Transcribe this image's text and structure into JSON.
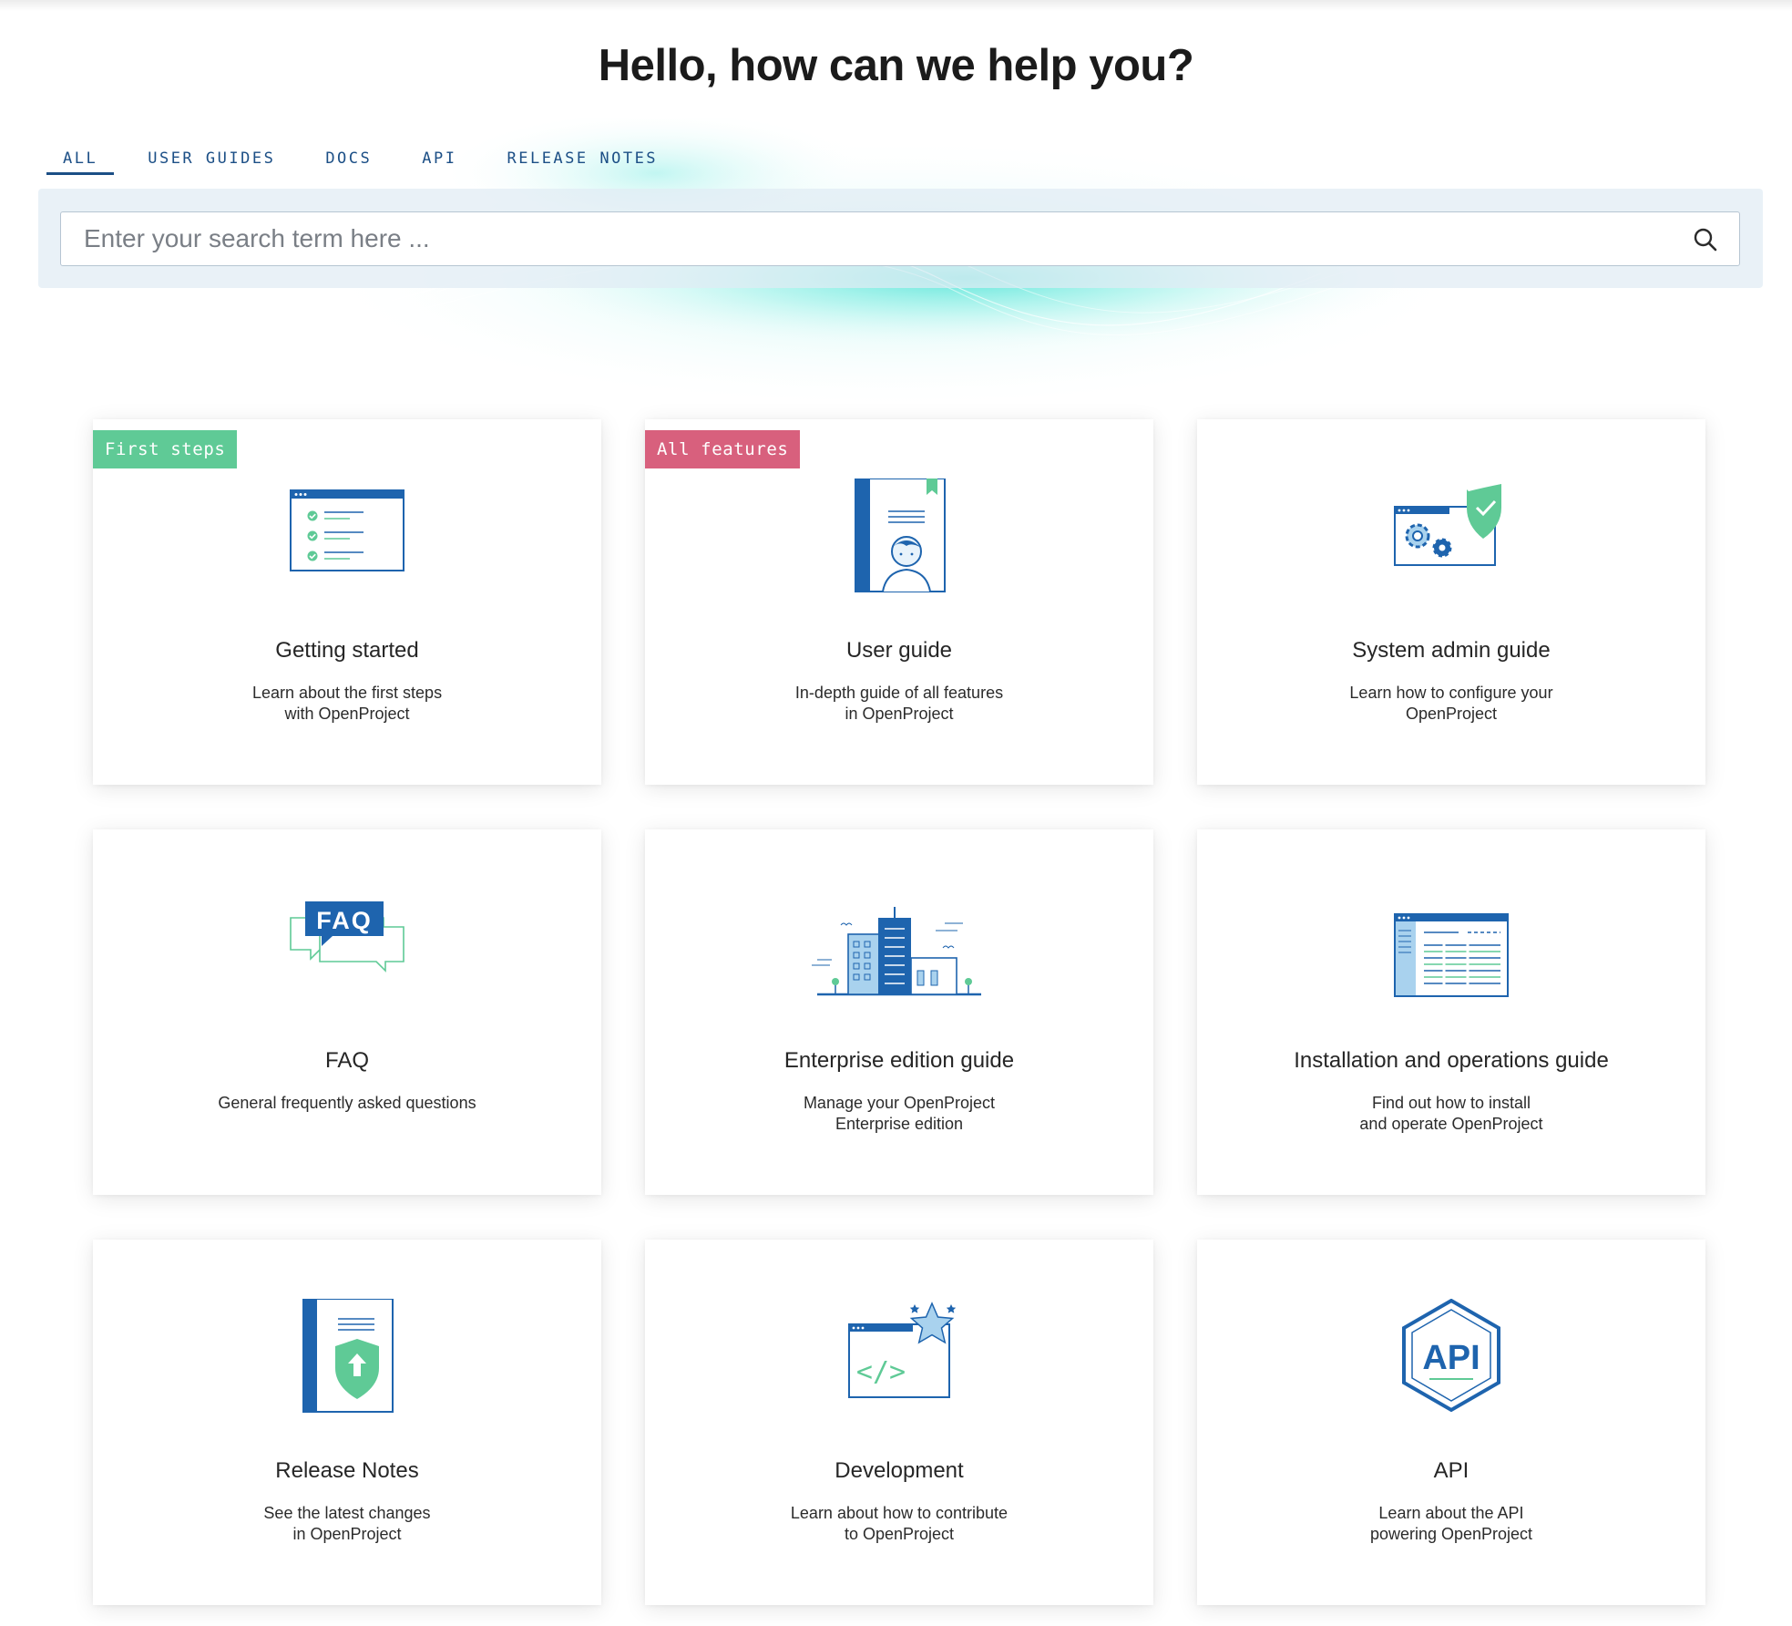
{
  "heading": "Hello, how can we help you?",
  "tabs": [
    {
      "label": "ALL",
      "active": true
    },
    {
      "label": "USER GUIDES",
      "active": false
    },
    {
      "label": "DOCS",
      "active": false
    },
    {
      "label": "API",
      "active": false
    },
    {
      "label": "RELEASE NOTES",
      "active": false
    }
  ],
  "search": {
    "placeholder": "Enter your search term here ...",
    "value": ""
  },
  "colors": {
    "primary_blue": "#1e64ae",
    "accent_green": "#5fca96",
    "accent_pink": "#d8607d",
    "light_blue": "#a9d2ee",
    "glow_cyan": "#5de0d8"
  },
  "cards": [
    {
      "title": "Getting started",
      "desc": [
        "Learn about the first steps",
        "with OpenProject"
      ],
      "badge": "First steps",
      "icon": "checklist-window-icon"
    },
    {
      "title": "User guide",
      "desc": [
        "In-depth guide of all features",
        "in OpenProject"
      ],
      "badge": "All features",
      "icon": "user-guide-book-icon"
    },
    {
      "title": "System admin guide",
      "desc": [
        "Learn how to configure your",
        "OpenProject"
      ],
      "badge": "",
      "icon": "admin-settings-shield-icon"
    },
    {
      "title": "FAQ",
      "desc": [
        "General frequently asked questions"
      ],
      "badge": "",
      "icon": "faq-chat-bubbles-icon"
    },
    {
      "title": "Enterprise edition guide",
      "desc": [
        "Manage your OpenProject",
        "Enterprise edition"
      ],
      "badge": "",
      "icon": "enterprise-building-icon"
    },
    {
      "title": "Installation and operations guide",
      "desc": [
        "Find out how to install",
        "and operate OpenProject"
      ],
      "badge": "",
      "icon": "installation-window-icon"
    },
    {
      "title": "Release Notes",
      "desc": [
        "See the latest changes",
        "in OpenProject"
      ],
      "badge": "",
      "icon": "release-notes-book-icon"
    },
    {
      "title": "Development",
      "desc": [
        "Learn about how to contribute",
        "to OpenProject"
      ],
      "badge": "",
      "icon": "code-window-star-icon"
    },
    {
      "title": "API",
      "desc": [
        "Learn about the API",
        "powering OpenProject"
      ],
      "badge": "",
      "icon": "api-hexagon-icon"
    }
  ]
}
